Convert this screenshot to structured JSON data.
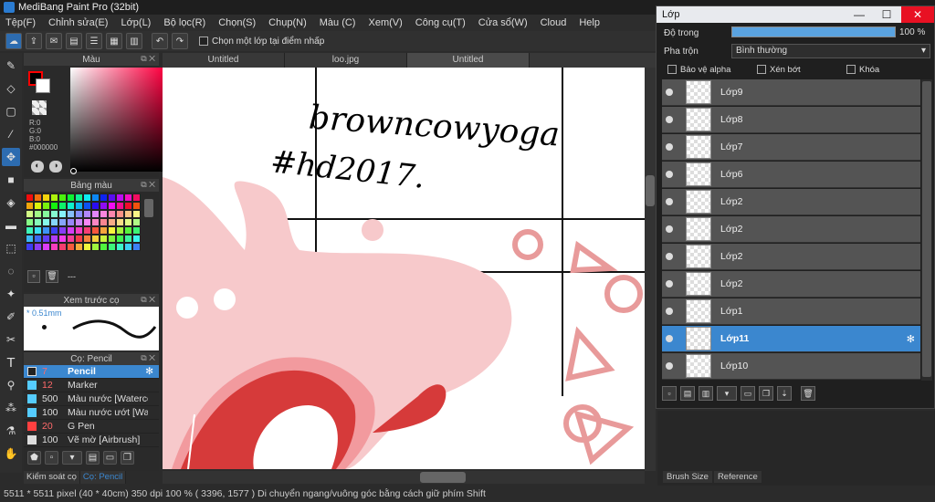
{
  "app": {
    "title": "MediBang Paint Pro (32bit)"
  },
  "menu": [
    "Tệp(F)",
    "Chỉnh sửa(E)",
    "Lớp(L)",
    "Bộ lọc(R)",
    "Chọn(S)",
    "Chụp(N)",
    "Màu (C)",
    "Xem(V)",
    "Công cụ(T)",
    "Cửa sổ(W)",
    "Cloud",
    "Help"
  ],
  "toolbar": {
    "select_layer_label": "Chọn một lớp tại điểm nhấp"
  },
  "panels": {
    "color_title": "Màu",
    "color_values": {
      "r": "R:0",
      "g": "G:0",
      "b": "B:0",
      "hex": "#000000"
    },
    "swatch_title": "Bảng màu",
    "swatch_footer": "---",
    "preview_title": "Xem trước cọ",
    "preview_size": "0.51mm",
    "brush_title": "Cọ: Pencil",
    "brushes": [
      {
        "size": "7",
        "name": "Pencil",
        "color": "#222222",
        "size_color": "#ff6a6a"
      },
      {
        "size": "12",
        "name": "Marker",
        "color": "#55ccff",
        "size_color": "#ff6a6a"
      },
      {
        "size": "500",
        "name": "Màu nước [Watercolo",
        "color": "#55ccff",
        "size_color": "#dddddd"
      },
      {
        "size": "100",
        "name": "Màu nước ướt [Wate",
        "color": "#55ccff",
        "size_color": "#dddddd"
      },
      {
        "size": "20",
        "name": "G Pen",
        "color": "#ff4040",
        "size_color": "#dddddd"
      },
      {
        "size": "100",
        "name": "Vẽ mờ [Airbrush]",
        "color": "#dddddd",
        "size_color": "#dddddd"
      }
    ],
    "bottom_tabs": [
      "Kiểm soát cọ",
      "Cọ: Pencil"
    ]
  },
  "tabs": [
    "Untitled",
    "loo.jpg",
    "Untitled"
  ],
  "canvas": {
    "text1": "browncowyoga",
    "text2": "#hd2017."
  },
  "status": "5511 * 5511 pixel   (40 * 40cm)  350 dpi  100 %   ( 3396, 1577 )   Di chuyển ngang/vuông góc bằng cách giữ phím Shift",
  "layers": {
    "title": "Lớp",
    "opacity_label": "Độ trong",
    "opacity_value": "100 %",
    "opacity": 1.0,
    "blend_label": "Pha trộn",
    "blend_value": "Bình thường",
    "protect_alpha": "Bảo vệ alpha",
    "clipping": "Xén bớt",
    "lock": "Khóa",
    "items": [
      "Lớp9",
      "Lớp8",
      "Lớp7",
      "Lớp6",
      "Lớp2",
      "Lớp2",
      "Lớp2",
      "Lớp2",
      "Lớp1",
      "Lớp11",
      "Lớp10"
    ],
    "selected_index": 9
  },
  "right_tabs": [
    "Brush Size",
    "Reference"
  ],
  "colors": {
    "accent": "#3b87cf",
    "bg": "#2b2b2b",
    "pink": "#f7c4c4",
    "red": "#d63a3a"
  }
}
